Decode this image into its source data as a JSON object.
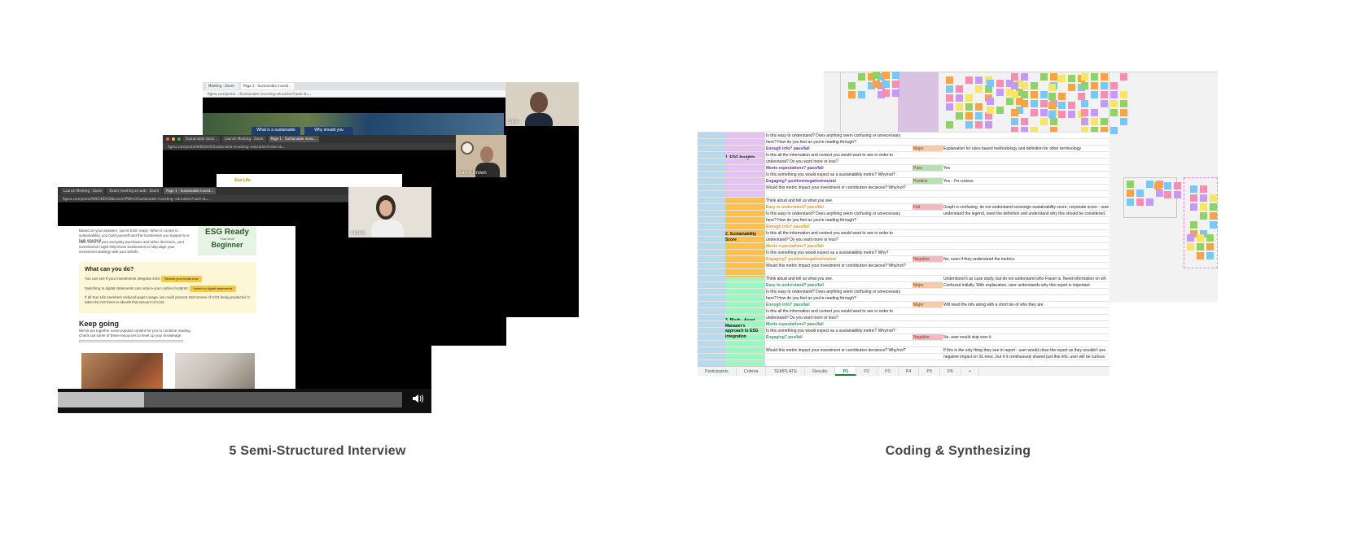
{
  "captions": {
    "left": "5 Semi-Structured Interview",
    "right": "Coding & Synthesizing"
  },
  "interview": {
    "back_window": {
      "tabs": [
        "Meeting - Zoom",
        "Page 1 - Sustainable investi..."
      ],
      "url": "figma.com/proto/.../Sustainable-investing-education?node-id=...",
      "participant_name": "Jane",
      "hero_labels": [
        "What is a sustainable",
        "Why should you"
      ]
    },
    "middle_window": {
      "tabs": [
        "Sustainable stock...",
        "Launch Meeting - Zoom",
        "Page 1 - Sustainable inves..."
      ],
      "url": "figma.com/proto/IH3DdeVS/Sustainable-investing--education?node-id=...",
      "participant_name": "Aaron Brown",
      "logo_text": "Sun Life"
    },
    "front_window": {
      "tabs": [
        "Launch Meeting - Zoom",
        "Zoom meeting on web - Zoom",
        "Page 1 - Sustainable invest..."
      ],
      "url": "figma.com/proto/AWEGNDVSNb/sxe/mPWKn0/Sustainable-investing--education?node-id=...",
      "participant_name": "Alisiah",
      "intro_text": "Based on your answers, you're ESG ready. When it comes to sustainability, you hold yourself and the businesses you support to a high standard.",
      "intro_text_2": "With some of your everyday purchases and other decisions, your investments might help those businesses to help align your investment strategy with your beliefs.",
      "esg": {
        "title": "ESG Ready",
        "level_label": "Your level",
        "level": "Beginner"
      },
      "todo": {
        "title": "What can you do?",
        "row1_text": "You can see if your investments integrate ESG",
        "row1_button": "Review your funds now",
        "row2_text": "Switching to digital statements can reduce your carbon footprint.",
        "row2_button": "Switch to digital statements",
        "row3_text": "If all Sun Life members reduced paper usage, we could prevent 150 tonnes of CO2 being produced. It takes 55,743 trees to absorb that amount of CO2."
      },
      "keep_going": {
        "title": "Keep going",
        "text": "We've put together some popular content for you to continue reading. Check out some of these resources to level up your knowledge."
      }
    },
    "player": {
      "progress": 0.25,
      "volume_icon": "speaker-icon"
    }
  },
  "coding": {
    "sections": [
      {
        "label": "1. ESG Insights",
        "color": "#e2c4ee"
      },
      {
        "label": "2. Sustainability Score",
        "color": "#ffc247"
      },
      {
        "label": "3. Blurb - Asset Manager's approach to ESG integration",
        "color": "#9cf8c2"
      }
    ],
    "rows": [
      {
        "q": "Is this easy to understand? Does anything seem confusing or unnecessary",
        "r": "",
        "c": ""
      },
      {
        "q": "here? How do you feel as you're reading through?",
        "r": "",
        "c": ""
      },
      {
        "q": "Enough info? pass/fail",
        "r": "Major",
        "c": "Explanation for rules based methodology and definition for other terminology",
        "crit": "#6b2fa0"
      },
      {
        "q": "Is this all the information and context you would want to see in order to",
        "r": "",
        "c": ""
      },
      {
        "q": "understand? Do you want more or less?",
        "r": "",
        "c": ""
      },
      {
        "q": "Meets expectations? pass/fail",
        "r": "Pass",
        "c": "Yes",
        "crit": "#6b2fa0"
      },
      {
        "q": "Is this something you would expect as a sustainability metric? Why/not?",
        "r": "",
        "c": ""
      },
      {
        "q": "Engaging? positive/negative/neutral",
        "r": "Positive",
        "c": "Yes - I'm curious",
        "crit": "#6b2fa0"
      },
      {
        "q": "Would this metric impact your investment or contribution decisions? Why/not?",
        "r": "",
        "c": ""
      },
      {
        "q": "",
        "r": "",
        "c": ""
      },
      {
        "q": "Think aloud and tell us what you see.",
        "r": "",
        "c": ""
      },
      {
        "q": "Easy to understand? pass/fail",
        "r": "Fail",
        "c": "Graph is confusing, do not understand sovereign sustainability score, corporate score - sure",
        "crit": "#e29a0a"
      },
      {
        "q": "Is this easy to understand? Does anything seem confusing or unnecessary",
        "r": "",
        "c": "understand the legend, need the definition and understand why this should be considered."
      },
      {
        "q": "here? How do you feel as you're reading through?",
        "r": "",
        "c": ""
      },
      {
        "q": "Enough info? pass/fail",
        "r": "",
        "c": "",
        "crit": "#e29a0a"
      },
      {
        "q": "Is this all the information and context you would want to see in order to",
        "r": "",
        "c": ""
      },
      {
        "q": "understand? Do you want more or less?",
        "r": "",
        "c": ""
      },
      {
        "q": "Meets expectations? pass/fail",
        "r": "",
        "c": "",
        "crit": "#e29a0a"
      },
      {
        "q": "Is this something you would expect as a sustainability metric? Why?",
        "r": "",
        "c": ""
      },
      {
        "q": "Engaging? positive/negative/neutral",
        "r": "Negative",
        "c": "No, even if they understand the metrics.",
        "crit": "#e29a0a"
      },
      {
        "q": "Would this metric impact your investment or contribution decisions? Why/not?",
        "r": "",
        "c": ""
      },
      {
        "q": "",
        "r": "",
        "c": ""
      },
      {
        "q": "Think aloud and tell us what you see.",
        "r": "",
        "c": "Understood it as case study, but do not understand who Fraser is. Need information on wh"
      },
      {
        "q": "Easy to understand? pass/fail",
        "r": "Major",
        "c": "Confused initially. With explanation, user understands why this report is important",
        "crit": "#2aa35a"
      },
      {
        "q": "Is this easy to understand? Does anything seem confusing or unnecessary",
        "r": "",
        "c": ""
      },
      {
        "q": "here? How do you feel as you're reading through?",
        "r": "",
        "c": ""
      },
      {
        "q": "Enough info? pass/fail",
        "r": "Major",
        "c": "Will need the info along with a short bio of who they are.",
        "crit": "#2aa35a"
      },
      {
        "q": "Is this all the information and context you would want to see in order to",
        "r": "",
        "c": ""
      },
      {
        "q": "understand? Do you want more or less?",
        "r": "",
        "c": ""
      },
      {
        "q": "Meets expectations? pass/fail",
        "r": "",
        "c": "",
        "crit": "#2aa35a"
      },
      {
        "q": "Is this something you would expect as a sustainability metric? Why/not?",
        "r": "",
        "c": ""
      },
      {
        "q": "Engaging? pos/fail",
        "r": "Negative",
        "c": "No, user would skip over it.",
        "crit": "#2aa35a"
      },
      {
        "q": "",
        "r": "",
        "c": ""
      },
      {
        "q": "Would this metric impact your investment or contribution decisions? Why/not?",
        "r": "",
        "c": "If this is the only thing they see in report - user would close the report as they wouldn't see"
      },
      {
        "q": "",
        "r": "",
        "c": "negative impact on SL enoc, but if it continuously shared just this info, user will be curious."
      }
    ],
    "rating_colors": {
      "Major": "#f8cba0",
      "Pass": "#b7e1b5",
      "Positive": "#b7e1b5",
      "Fail": "#f7b6c0",
      "Negative": "#f7b6c0"
    },
    "tabs": [
      "Participants",
      "Criteria",
      "TEMPLATE",
      "Results",
      "P1",
      "P2",
      "P3",
      "P4",
      "P5",
      "P6",
      "+"
    ],
    "active_tab": "P1"
  }
}
